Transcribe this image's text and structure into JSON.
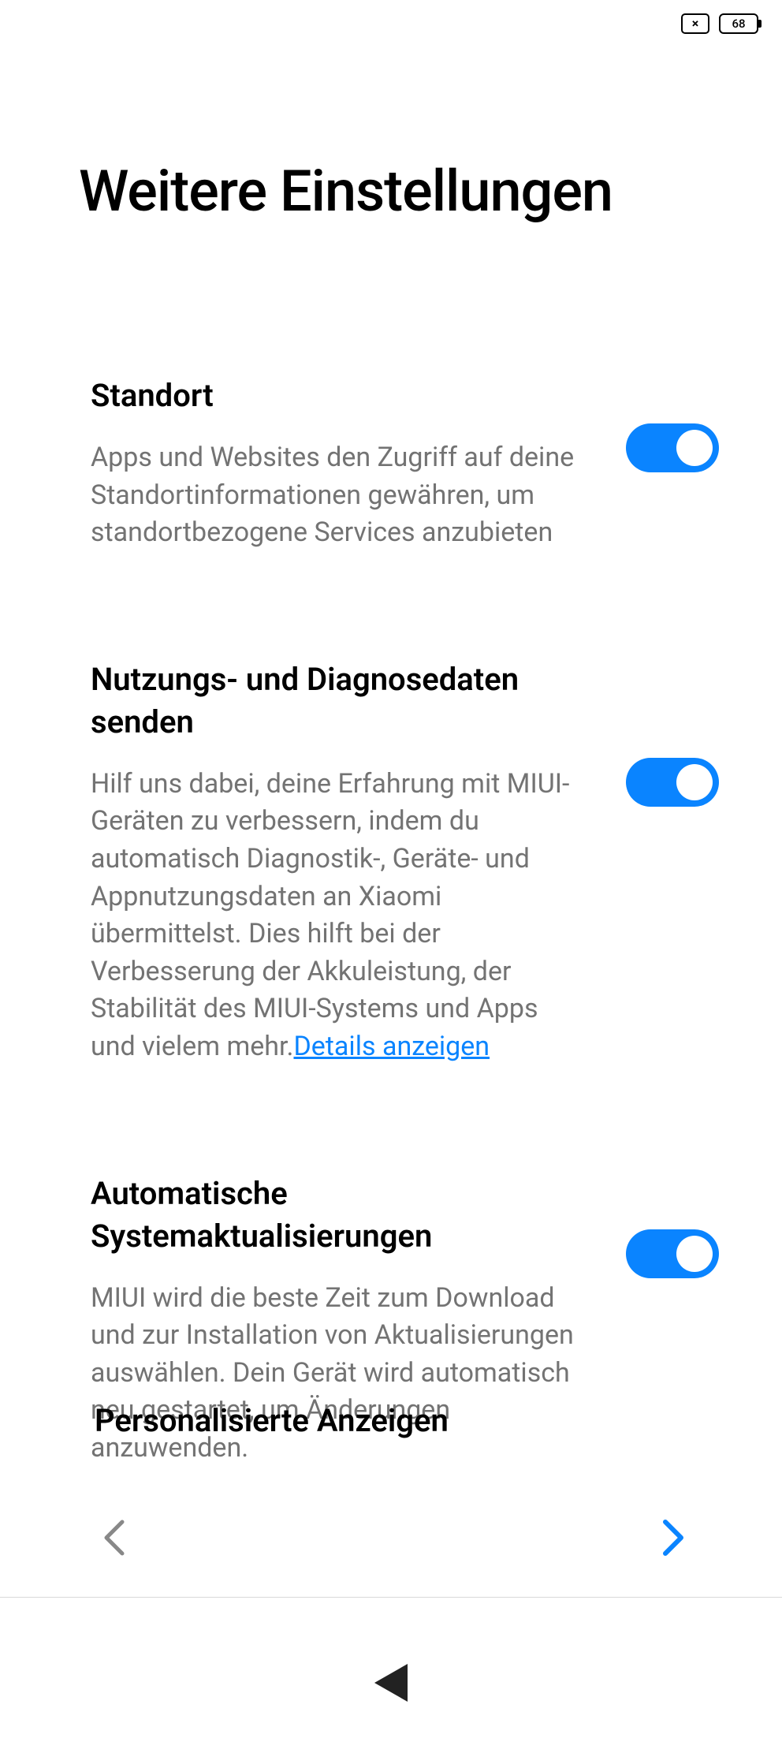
{
  "status_bar": {
    "sim_status": "×",
    "battery_level": "68"
  },
  "page_title": "Weitere Einstellungen",
  "settings": {
    "location": {
      "title": "Standort",
      "description": "Apps und Websites den Zugriff auf deine Standortinformationen gewähren, um standortbezogene Services anzubieten",
      "enabled": true
    },
    "diagnostics": {
      "title": "Nutzungs- und Diagnosedaten senden",
      "description": "Hilf uns dabei, deine Erfahrung mit MIUI-Geräten zu verbessern, indem du automatisch Diagnostik-, Geräte- und Appnutzungsdaten an Xiaomi übermittelst. Dies hilft bei der Verbesserung der Akkuleistung, der Stabilität des MIUI-Systems und Apps und vielem mehr.",
      "details_link": "Details anzeigen",
      "enabled": true
    },
    "auto_updates": {
      "title": "Automatische Systemaktualisierungen",
      "description": "MIUI wird die beste Zeit zum Download und zur Installation von Aktualisierungen auswählen. Dein Gerät wird automatisch neu gestartet, um Änderungen anzuwenden.",
      "enabled": true
    },
    "personalized_ads": {
      "title": "Personalisierte Anzeigen"
    }
  }
}
